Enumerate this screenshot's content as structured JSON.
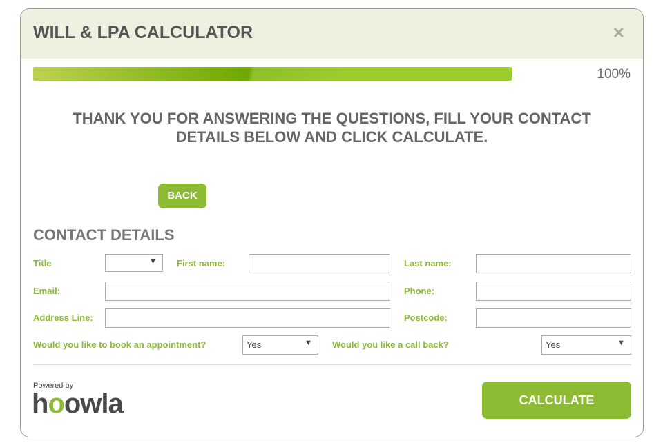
{
  "header": {
    "title": "WILL & LPA CALCULATOR",
    "close_icon": "close-icon"
  },
  "progress": {
    "value_percent": 100,
    "label": "100%"
  },
  "message": {
    "line1": "THANK YOU FOR ANSWERING THE QUESTIONS, FILL YOUR CONTACT",
    "line2": "DETAILS BELOW AND CLICK CALCULATE."
  },
  "back_label": "BACK",
  "contact": {
    "heading": "CONTACT DETAILS",
    "title_label": "Title",
    "title_value": "",
    "first_name_label": "First name:",
    "last_name_label": "Last name:",
    "email_label": "Email:",
    "phone_label": "Phone:",
    "address_label": "Address Line:",
    "postcode_label": "Postcode:",
    "appointment_label": "Would you like to book an appointment?",
    "appointment_value": "Yes",
    "callback_label": "Would you like a call back?",
    "callback_value": "Yes"
  },
  "footer": {
    "powered_by": "Powered by",
    "logo_text": "hoowla",
    "calculate_label": "CALCULATE"
  },
  "colors": {
    "accent": "#8dbb34",
    "header_bg": "#edf2e0"
  }
}
